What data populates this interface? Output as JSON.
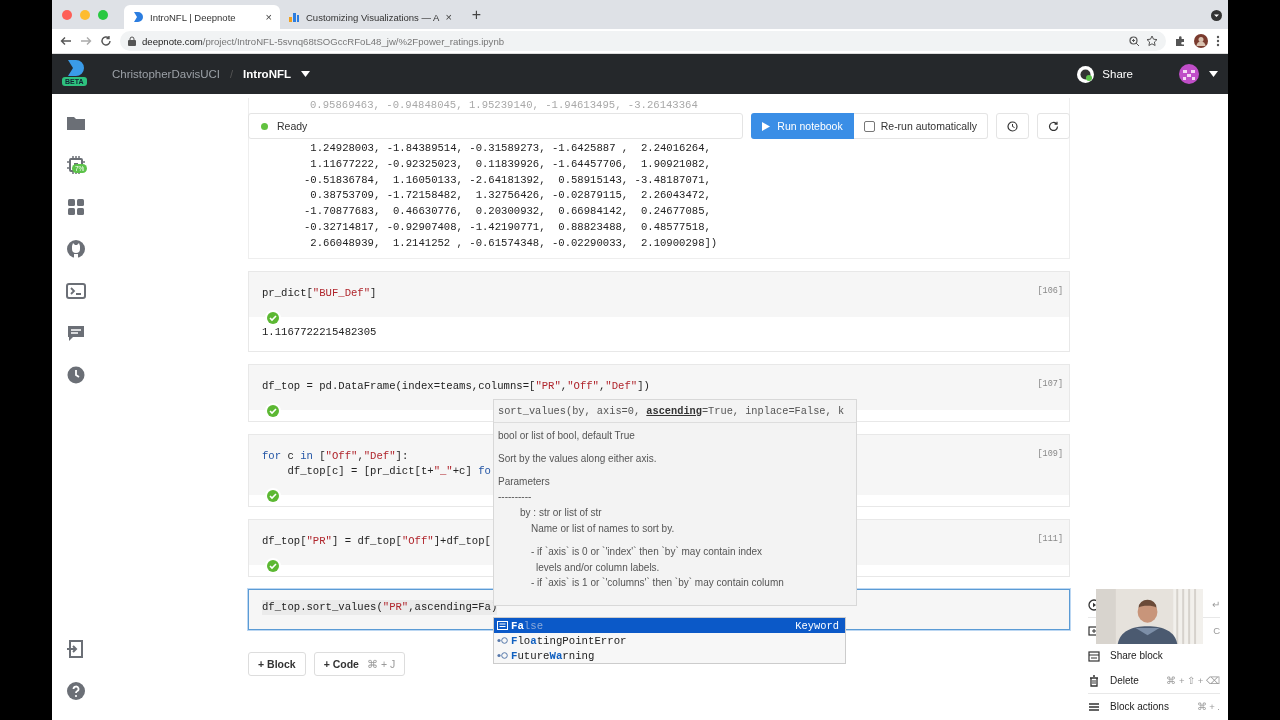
{
  "browser": {
    "tabs": [
      {
        "title": "IntroNFL | Deepnote",
        "selected": true,
        "close": "×"
      },
      {
        "title": "Customizing Visualizations — A",
        "selected": false,
        "close": "×"
      }
    ],
    "new_tab": "+",
    "url": {
      "domain": "deepnote.com",
      "path": "/project/IntroNFL-5svnq68tSOGccRFoL48_jw/%2Fpower_ratings.ipynb"
    }
  },
  "header": {
    "badge": "BETA",
    "workspace": "ChristopherDavisUCI",
    "separator": "/",
    "project": "IntroNFL",
    "share": "Share"
  },
  "sidebar": {
    "items": [
      {
        "kind": "folder"
      },
      {
        "kind": "chip",
        "badge": "7%"
      },
      {
        "kind": "grid"
      },
      {
        "kind": "cat"
      },
      {
        "kind": "terminal"
      },
      {
        "kind": "comment"
      },
      {
        "kind": "clock"
      }
    ],
    "bottom": [
      {
        "kind": "import"
      },
      {
        "kind": "help"
      }
    ]
  },
  "toolbar": {
    "status": "Ready",
    "run": "Run notebook",
    "rerun": {
      "label": "Re-run automatically",
      "checked": false
    }
  },
  "cells": [
    {
      "kind": "output",
      "faded": "0.95869463, -0.94848045, 1.95239140, -1.94613495, -3.26143364",
      "output": [
        " 1.24928003, -1.84389514, -0.31589273, -1.6425887 ,  2.24016264,",
        " 1.11677222, -0.92325023,  0.11839926, -1.64457706,  1.90921082,",
        "-0.51836784,  1.16050133, -2.64181392,  0.58915143, -3.48187071,",
        " 0.38753709, -1.72158482,  1.32756426, -0.02879115,  2.26043472,",
        "-1.70877683,  0.46630776,  0.20300932,  0.66984142,  0.24677085,",
        "-0.32714817, -0.92907408, -1.42190771,  0.88823488,  0.48577518,",
        " 2.66048939,  1.2141252 , -0.61574348, -0.02290033,  2.10900298])"
      ]
    },
    {
      "kind": "code",
      "count": "[106]",
      "succeeded": true,
      "active": false,
      "code": [
        [
          {
            "t": "pr_dict[",
            "kind": "plain"
          },
          {
            "t": "\"BUF_Def\"",
            "kind": "str"
          },
          {
            "t": "]",
            "kind": "plain"
          }
        ]
      ],
      "output": [
        "1.1167722215482305"
      ]
    },
    {
      "kind": "code",
      "count": "[107]",
      "succeeded": true,
      "active": false,
      "code": [
        [
          {
            "t": "df_top = pd.DataFrame(index=teams,columns=[",
            "kind": "plain"
          },
          {
            "t": "\"PR\"",
            "kind": "str"
          },
          {
            "t": ",",
            "kind": "plain"
          },
          {
            "t": "\"Off\"",
            "kind": "str"
          },
          {
            "t": ",",
            "kind": "plain"
          },
          {
            "t": "\"Def\"",
            "kind": "str"
          },
          {
            "t": "])",
            "kind": "plain"
          }
        ]
      ]
    },
    {
      "kind": "code",
      "count": "[109]",
      "succeeded": true,
      "active": false,
      "code": [
        [
          {
            "t": "for",
            "kind": "kw"
          },
          {
            "t": " c ",
            "kind": "plain"
          },
          {
            "t": "in",
            "kind": "kw"
          },
          {
            "t": " [",
            "kind": "plain"
          },
          {
            "t": "\"Off\"",
            "kind": "str"
          },
          {
            "t": ",",
            "kind": "plain"
          },
          {
            "t": "\"Def\"",
            "kind": "str"
          },
          {
            "t": "]:",
            "kind": "plain"
          }
        ],
        [
          {
            "t": "    df_top[c] = [pr_dict[t+",
            "kind": "plain"
          },
          {
            "t": "\"_\"",
            "kind": "str"
          },
          {
            "t": "+c] ",
            "kind": "plain"
          },
          {
            "t": "fo",
            "kind": "kw"
          }
        ]
      ]
    },
    {
      "kind": "code",
      "count": "[111]",
      "succeeded": true,
      "active": false,
      "code": [
        [
          {
            "t": "df_top[",
            "kind": "plain"
          },
          {
            "t": "\"PR\"",
            "kind": "str"
          },
          {
            "t": "] = df_top[",
            "kind": "plain"
          },
          {
            "t": "\"Off\"",
            "kind": "str"
          },
          {
            "t": "]+df_top[",
            "kind": "plain"
          }
        ]
      ]
    },
    {
      "kind": "code",
      "succeeded": false,
      "active": true,
      "code": [
        [
          {
            "t": "df_top.sort_values(",
            "kind": "plain"
          },
          {
            "t": "\"PR\"",
            "kind": "str"
          },
          {
            "t": ",ascending=Fa)",
            "kind": "plain"
          }
        ]
      ]
    }
  ],
  "add_buttons": [
    {
      "label": "+ Block"
    },
    {
      "label": "+ Code",
      "shortcut": "⌘ + J"
    }
  ],
  "signature_help": {
    "signature": "sort_values(by, axis=0, **ascending**=True, inplace=False, k",
    "doc": [
      [
        {
          "text": "bool or list of bool, default True",
          "kind": "plain"
        }
      ],
      [
        {
          "text": "Sort by the values along either axis.",
          "kind": "plain"
        }
      ],
      [
        {
          "text": "Parameters",
          "kind": "plain"
        },
        {
          "text": "----------",
          "kind": "plain"
        },
        {
          "text": "by : str or list of str",
          "kind": "param"
        },
        {
          "text": "Name or list of names to sort by.",
          "kind": "desc"
        }
      ],
      [
        {
          "text": "- if `axis` is 0 or `'index'` then `by` may contain index",
          "kind": "desc"
        },
        {
          "text": "levels and/or column labels.",
          "kind": "cont"
        },
        {
          "text": "- if `axis` is 1 or `'columns'` then `by` may contain column",
          "kind": "desc"
        }
      ]
    ]
  },
  "completions": [
    {
      "label": "**Fa**lse",
      "type": "Keyword",
      "kind": "keyword",
      "selected": true
    },
    {
      "label": "**F**lo**a**tingPointError",
      "kind": "class",
      "selected": false
    },
    {
      "label": "**F**uture**Wa**rning",
      "kind": "class",
      "selected": false
    }
  ],
  "block_menu": {
    "items": [
      {
        "kind": "run",
        "shortcut": "↵"
      },
      {
        "kind": "copy",
        "shortcut": "C"
      },
      {
        "kind": "share",
        "label": "Share block"
      },
      {
        "kind": "delete",
        "label": "Delete",
        "shortcut": "⌘ + ⇧ + ⌫"
      },
      {
        "kind": "actions",
        "label": "Block actions",
        "shortcut": "⌘ + ."
      }
    ]
  }
}
